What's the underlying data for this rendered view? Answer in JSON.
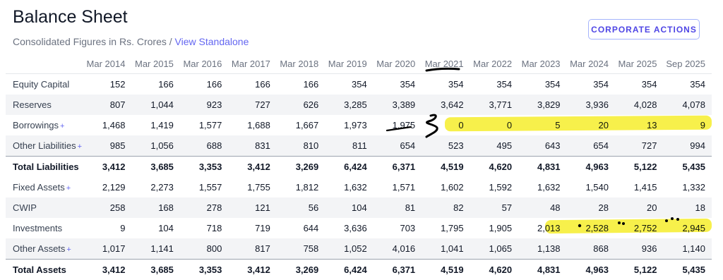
{
  "header": {
    "title": "Balance Sheet",
    "subtitle_text": "Consolidated Figures in Rs. Crores / ",
    "subtitle_link": "View Standalone",
    "action_button": "CORPORATE ACTIONS"
  },
  "table": {
    "columns": [
      "Mar 2014",
      "Mar 2015",
      "Mar 2016",
      "Mar 2017",
      "Mar 2018",
      "Mar 2019",
      "Mar 2020",
      "Mar 2021",
      "Mar 2022",
      "Mar 2023",
      "Mar 2024",
      "Mar 2025",
      "Sep 2025"
    ],
    "rows": [
      {
        "label": "Equity Capital",
        "expandable": false,
        "total": false,
        "values": [
          "152",
          "166",
          "166",
          "166",
          "166",
          "354",
          "354",
          "354",
          "354",
          "354",
          "354",
          "354",
          "354"
        ]
      },
      {
        "label": "Reserves",
        "expandable": false,
        "total": false,
        "values": [
          "807",
          "1,044",
          "923",
          "727",
          "626",
          "3,285",
          "3,389",
          "3,642",
          "3,771",
          "3,829",
          "3,936",
          "4,028",
          "4,078"
        ]
      },
      {
        "label": "Borrowings",
        "expandable": true,
        "total": false,
        "values": [
          "1,468",
          "1,419",
          "1,577",
          "1,688",
          "1,667",
          "1,973",
          "1,975",
          "0",
          "0",
          "5",
          "20",
          "13",
          "9"
        ]
      },
      {
        "label": "Other Liabilities",
        "expandable": true,
        "total": false,
        "values": [
          "985",
          "1,056",
          "688",
          "831",
          "810",
          "811",
          "654",
          "523",
          "495",
          "643",
          "654",
          "727",
          "994"
        ]
      },
      {
        "label": "Total Liabilities",
        "expandable": false,
        "total": true,
        "values": [
          "3,412",
          "3,685",
          "3,353",
          "3,412",
          "3,269",
          "6,424",
          "6,371",
          "4,519",
          "4,620",
          "4,831",
          "4,963",
          "5,122",
          "5,435"
        ]
      },
      {
        "label": "Fixed Assets",
        "expandable": true,
        "total": false,
        "values": [
          "2,129",
          "2,273",
          "1,557",
          "1,755",
          "1,812",
          "1,632",
          "1,571",
          "1,602",
          "1,592",
          "1,632",
          "1,540",
          "1,415",
          "1,332"
        ]
      },
      {
        "label": "CWIP",
        "expandable": false,
        "total": false,
        "values": [
          "258",
          "168",
          "278",
          "121",
          "56",
          "104",
          "81",
          "82",
          "57",
          "48",
          "28",
          "20",
          "18"
        ]
      },
      {
        "label": "Investments",
        "expandable": false,
        "total": false,
        "values": [
          "9",
          "104",
          "718",
          "719",
          "644",
          "3,636",
          "703",
          "1,795",
          "1,905",
          "2,013",
          "2,528",
          "2,752",
          "2,945"
        ]
      },
      {
        "label": "Other Assets",
        "expandable": true,
        "total": false,
        "values": [
          "1,017",
          "1,141",
          "800",
          "817",
          "758",
          "1,052",
          "4,016",
          "1,041",
          "1,065",
          "1,138",
          "868",
          "936",
          "1,140"
        ]
      },
      {
        "label": "Total Assets",
        "expandable": false,
        "total": true,
        "values": [
          "3,412",
          "3,685",
          "3,353",
          "3,412",
          "3,269",
          "6,424",
          "6,371",
          "4,519",
          "4,620",
          "4,831",
          "4,963",
          "5,122",
          "5,435"
        ]
      }
    ]
  },
  "annotations": {
    "highlight_color": "#f6ee2b",
    "ink_color": "#000000"
  }
}
